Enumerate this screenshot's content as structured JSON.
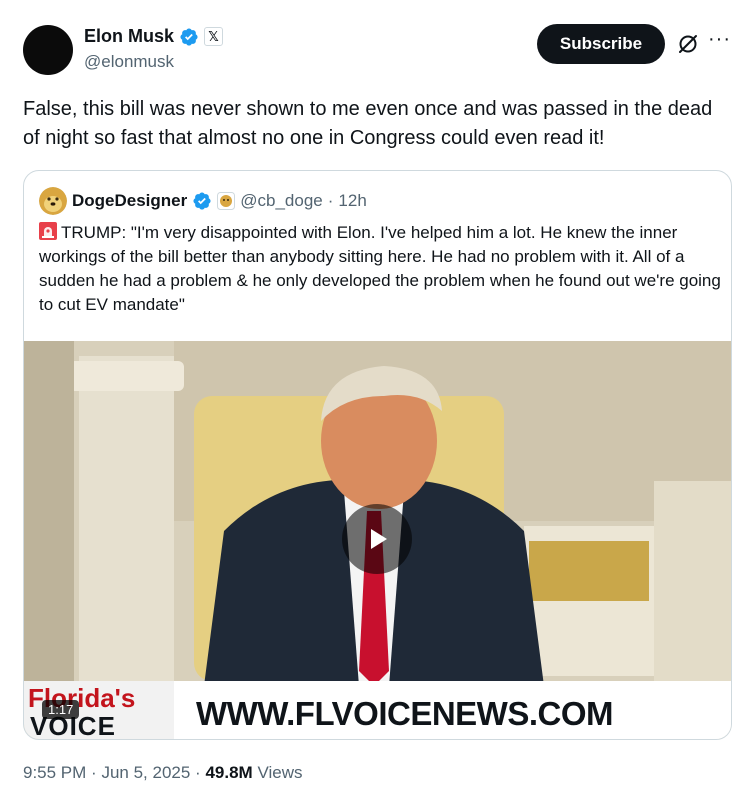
{
  "author": {
    "name": "Elon Musk",
    "handle": "@elonmusk",
    "avatar_icon": "black-circle-avatar",
    "verified_icon": "blue-check-badge",
    "affiliate_badge": "𝕏"
  },
  "actions": {
    "subscribe_label": "Subscribe",
    "grok_icon": "grok-icon",
    "more_icon": "···"
  },
  "tweet": {
    "text": "False, this bill was never shown to me even once and was passed in the dead of night so fast that almost no one in Congress could even read it!"
  },
  "quote": {
    "author_name": "DogeDesigner",
    "handle": "@cb_doge",
    "separator": "·",
    "time": "12h",
    "avatar_icon": "doge-avatar",
    "verified_icon": "blue-check-badge",
    "affiliate_icon": "doge-badge",
    "siren_icon": "siren-emoji",
    "text": "TRUMP: \"I'm very disappointed with Elon. I've helped him a lot. He knew the inner workings of the bill better than anybody sitting here. He had no problem with it. All of a sudden he had a problem & he only developed the problem when he found out we're going to cut EV mandate\"",
    "video": {
      "duration": "1:17",
      "play_icon": "play-icon",
      "logo_line1": "Florida's",
      "logo_line2": "VOICE",
      "banner_url": "WWW.FLVOICENEWS.COM"
    }
  },
  "meta": {
    "time": "9:55 PM",
    "sep1": "·",
    "date": "Jun 5, 2025",
    "sep2": "·",
    "views_count": "49.8M",
    "views_label": "Views"
  },
  "colors": {
    "text_primary": "#0f1419",
    "text_secondary": "#536471",
    "verified_blue": "#1d9bf0",
    "border": "#cfd9de"
  }
}
